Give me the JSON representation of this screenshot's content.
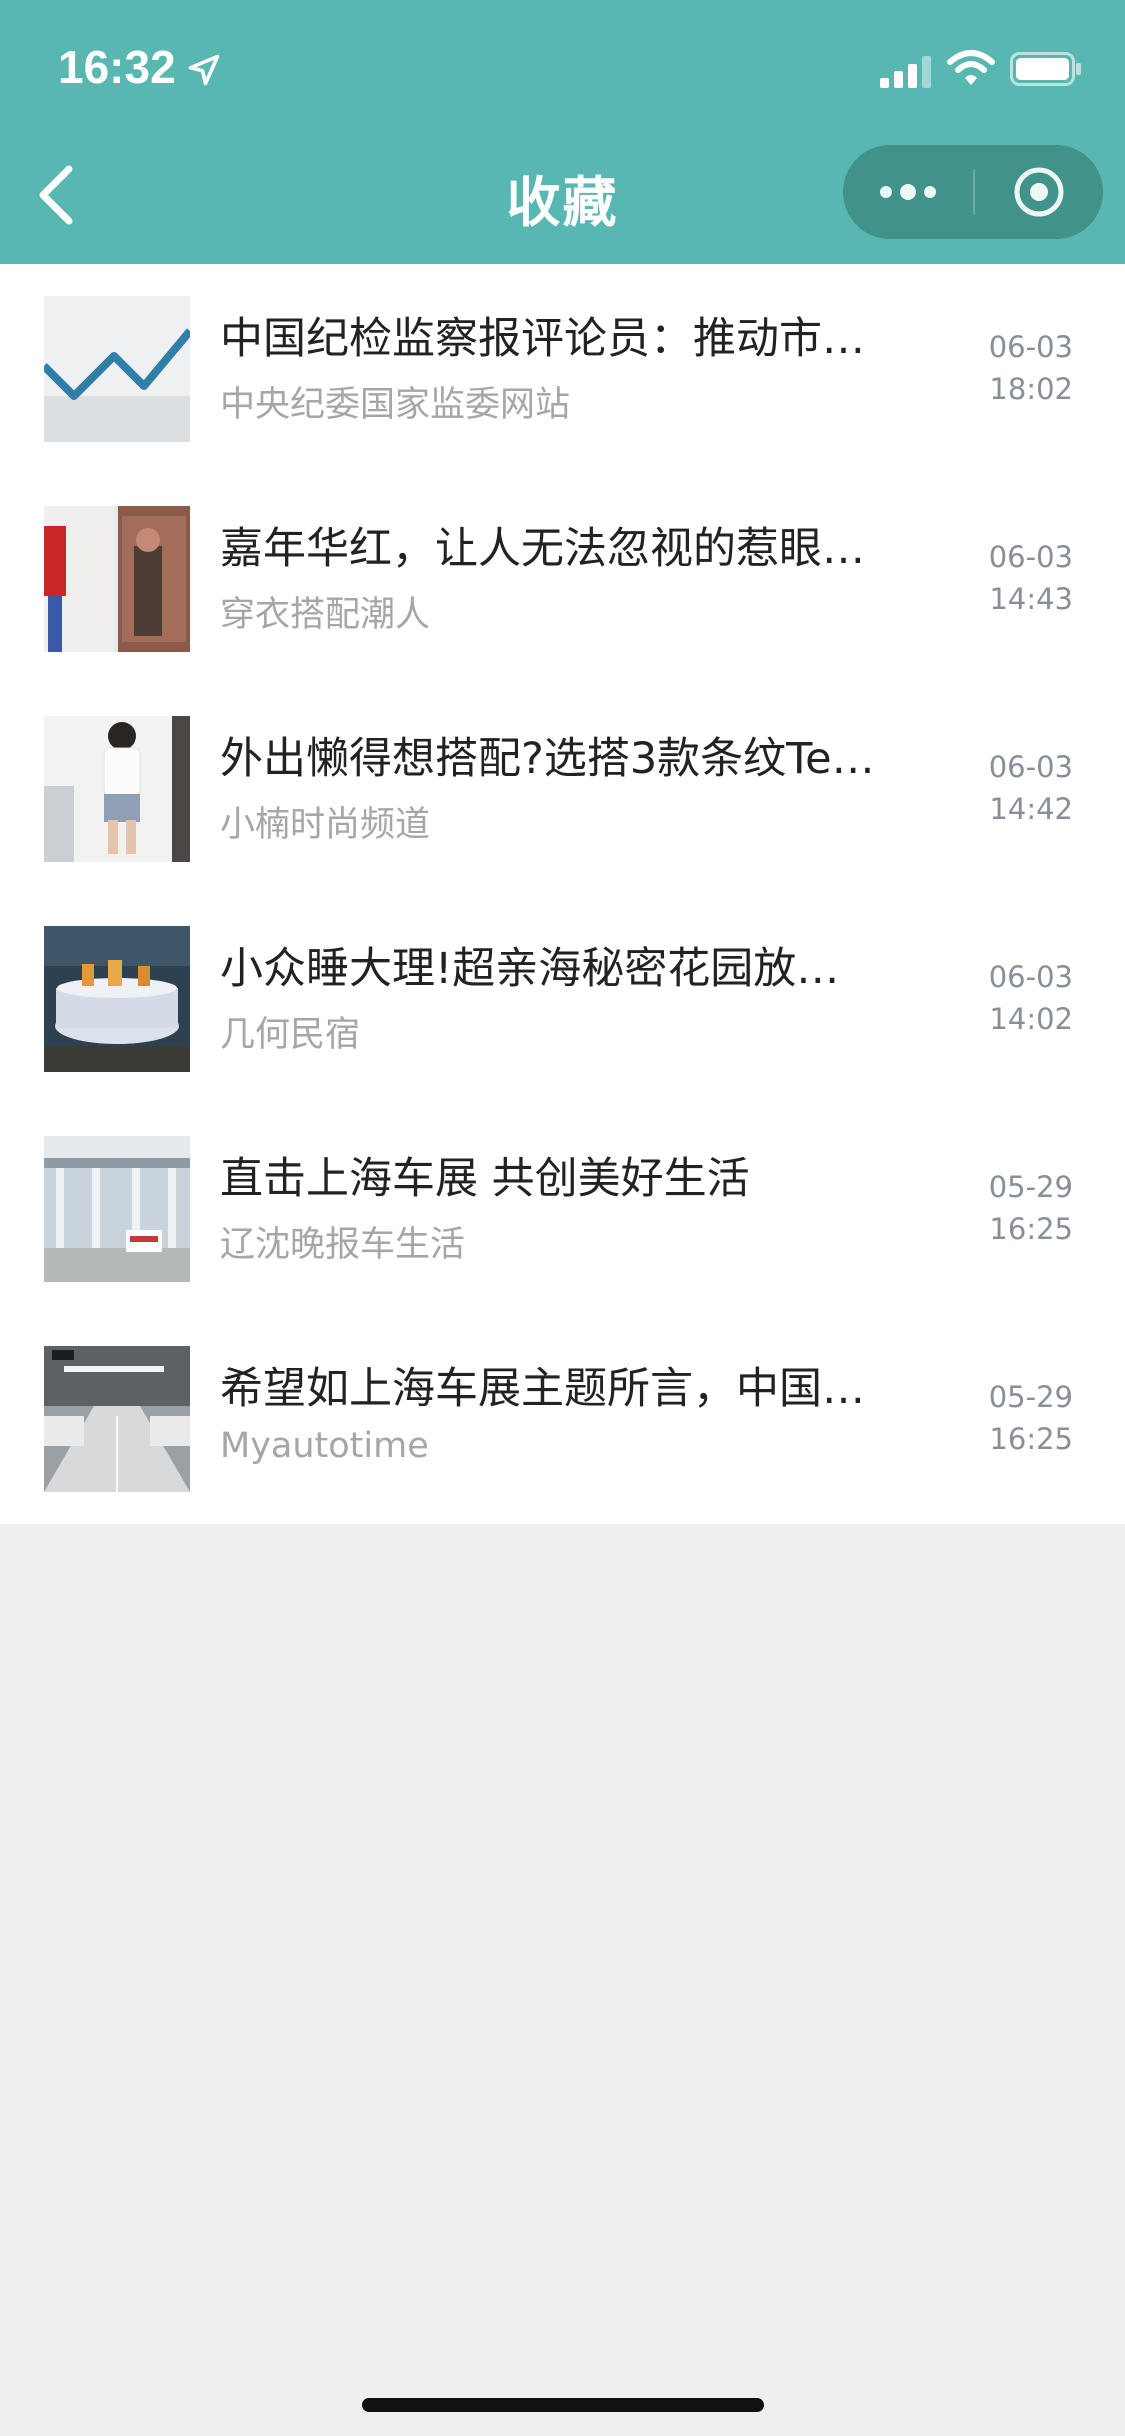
{
  "status_bar": {
    "time": "16:32"
  },
  "nav": {
    "title": "收藏"
  },
  "items": [
    {
      "title": "中国纪检监察报评论员：推动市…",
      "source": "中央纪委国家监委网站",
      "date": "06-03",
      "time": "18:02"
    },
    {
      "title": "嘉年华红，让人无法忽视的惹眼…",
      "source": "穿衣搭配潮人",
      "date": "06-03",
      "time": "14:43"
    },
    {
      "title": "外出懒得想搭配?选搭3款条纹Te…",
      "source": "小楠时尚频道",
      "date": "06-03",
      "time": "14:42"
    },
    {
      "title": "小众睡大理!超亲海秘密花园放…",
      "source": "几何民宿",
      "date": "06-03",
      "time": "14:02"
    },
    {
      "title": "直击上海车展 共创美好生活",
      "source": "辽沈晚报车生活",
      "date": "05-29",
      "time": "16:25"
    },
    {
      "title": "希望如上海车展主题所言，中国…",
      "source": "Myautotime",
      "date": "05-29",
      "time": "16:25"
    }
  ],
  "colors": {
    "header": "#58b7b0",
    "background": "#efefef",
    "title_text": "#222222",
    "source_text": "#a6a6a6",
    "date_text": "#888f99"
  }
}
